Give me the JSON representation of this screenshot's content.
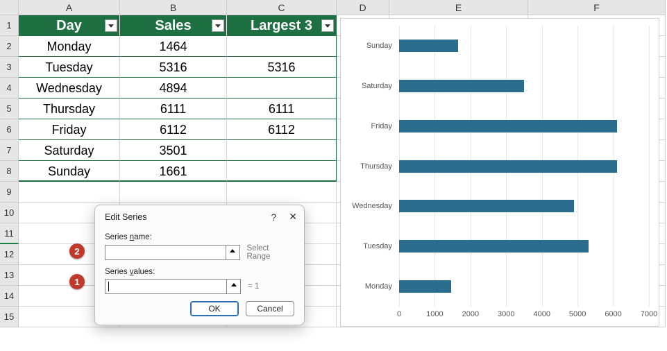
{
  "columns": [
    "A",
    "B",
    "C",
    "D",
    "E",
    "F"
  ],
  "row_numbers": [
    1,
    2,
    3,
    4,
    5,
    6,
    7,
    8,
    9,
    10,
    11,
    12,
    13,
    14,
    15
  ],
  "table": {
    "headers": {
      "day": "Day",
      "sales": "Sales",
      "largest": "Largest 3"
    },
    "rows": [
      {
        "day": "Monday",
        "sales": "1464",
        "largest": ""
      },
      {
        "day": "Tuesday",
        "sales": "5316",
        "largest": "5316"
      },
      {
        "day": "Wednesday",
        "sales": "4894",
        "largest": ""
      },
      {
        "day": "Thursday",
        "sales": "6111",
        "largest": "6111"
      },
      {
        "day": "Friday",
        "sales": "6112",
        "largest": "6112"
      },
      {
        "day": "Saturday",
        "sales": "3501",
        "largest": ""
      },
      {
        "day": "Sunday",
        "sales": "1661",
        "largest": ""
      }
    ]
  },
  "dialog": {
    "title": "Edit Series",
    "help": "?",
    "name_label_pre": "Series ",
    "name_label_u": "n",
    "name_label_post": "ame:",
    "name_value": "",
    "name_hint": "Select Range",
    "values_label_pre": "Series ",
    "values_label_u": "v",
    "values_label_post": "alues:",
    "values_value": "",
    "values_hint": "= 1",
    "ok": "OK",
    "cancel": "Cancel"
  },
  "badges": {
    "b1": "1",
    "b2": "2"
  },
  "chart_data": {
    "type": "bar",
    "orientation": "horizontal",
    "categories": [
      "Sunday",
      "Saturday",
      "Friday",
      "Thursday",
      "Wednesday",
      "Tuesday",
      "Monday"
    ],
    "values": [
      1661,
      3501,
      6112,
      6111,
      4894,
      5316,
      1464
    ],
    "xlabel": "",
    "ylabel": "",
    "xlim": [
      0,
      7000
    ],
    "ticks": [
      0,
      1000,
      2000,
      3000,
      4000,
      5000,
      6000,
      7000
    ],
    "bar_color": "#2b6d8f"
  }
}
